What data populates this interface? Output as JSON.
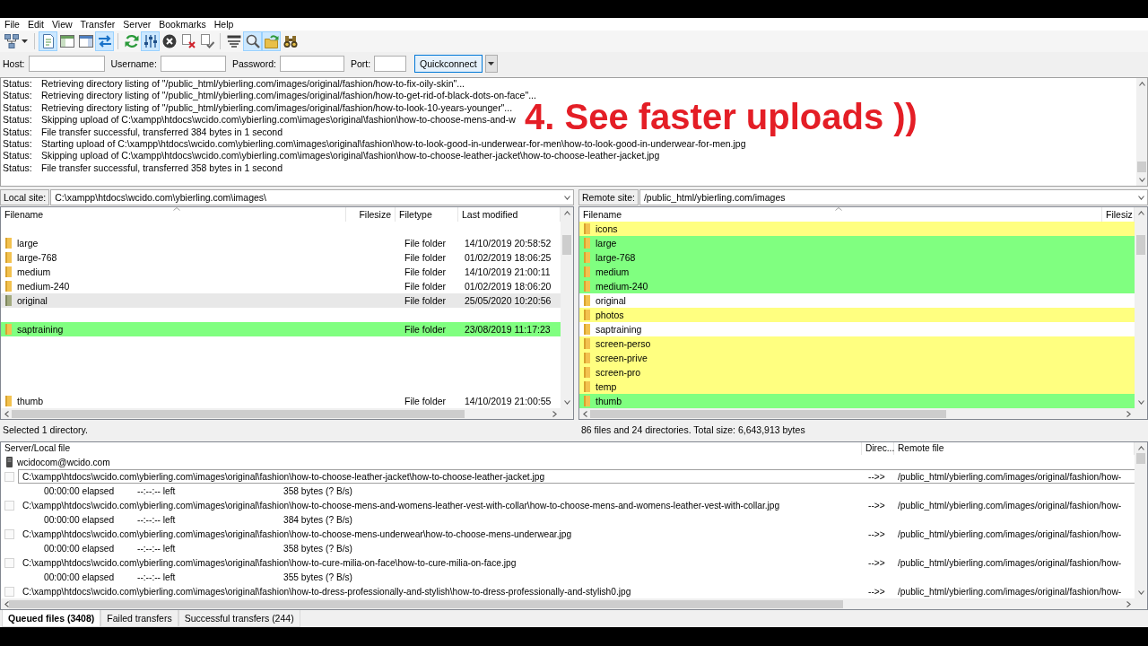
{
  "menu": [
    "File",
    "Edit",
    "View",
    "Transfer",
    "Server",
    "Bookmarks",
    "Help"
  ],
  "toolbar": [
    {
      "kind": "sitemanager",
      "pressed": false
    },
    {
      "kind": "separator"
    },
    {
      "kind": "log",
      "pressed": true
    },
    {
      "kind": "localtree",
      "pressed": false
    },
    {
      "kind": "remotetree",
      "pressed": false
    },
    {
      "kind": "queue",
      "pressed": true
    },
    {
      "kind": "separator"
    },
    {
      "kind": "refresh",
      "pressed": false
    },
    {
      "kind": "process",
      "pressed": true
    },
    {
      "kind": "cancel",
      "pressed": false
    },
    {
      "kind": "disconnect",
      "pressed": false
    },
    {
      "kind": "reconnect",
      "pressed": false
    },
    {
      "kind": "separator"
    },
    {
      "kind": "filter",
      "pressed": false
    },
    {
      "kind": "compare",
      "pressed": true
    },
    {
      "kind": "sync",
      "pressed": true
    },
    {
      "kind": "search",
      "pressed": false
    }
  ],
  "quickconnect": {
    "fields": [
      {
        "label": "Host:"
      },
      {
        "label": "Username:"
      },
      {
        "label": "Password:"
      },
      {
        "label": "Port:"
      }
    ],
    "button": "Quickconnect"
  },
  "message_log": {
    "lines": [
      {
        "label": "Status:",
        "text": "Retrieving directory listing of \"/public_html/ybierling.com/images/original/fashion/how-to-fix-oily-skin\"..."
      },
      {
        "label": "Status:",
        "text": "Retrieving directory listing of \"/public_html/ybierling.com/images/original/fashion/how-to-get-rid-of-black-dots-on-face\"..."
      },
      {
        "label": "Status:",
        "text": "Retrieving directory listing of \"/public_html/ybierling.com/images/original/fashion/how-to-look-10-years-younger\"..."
      },
      {
        "label": "Status:",
        "text": "Skipping upload of C:\\xampp\\htdocs\\wcido.com\\ybierling.com\\images\\original\\fashion\\how-to-choose-mens-and-w"
      },
      {
        "label": "Status:",
        "text": "File transfer successful, transferred 384 bytes in 1 second"
      },
      {
        "label": "Status:",
        "text": "Starting upload of C:\\xampp\\htdocs\\wcido.com\\ybierling.com\\images\\original\\fashion\\how-to-look-good-in-underwear-for-men\\how-to-look-good-in-underwear-for-men.jpg"
      },
      {
        "label": "Status:",
        "text": "Skipping upload of C:\\xampp\\htdocs\\wcido.com\\ybierling.com\\images\\original\\fashion\\how-to-choose-leather-jacket\\how-to-choose-leather-jacket.jpg"
      },
      {
        "label": "Status:",
        "text": "File transfer successful, transferred 358 bytes in 1 second"
      }
    ]
  },
  "video_caption": {
    "text": "4. See faster uploads ))"
  },
  "local_site": {
    "label": "Local site:",
    "path": "C:\\xampp\\htdocs\\wcido.com\\ybierling.com\\images\\",
    "columns": [
      "Filename",
      "Filesize",
      "Filetype",
      "Last modified"
    ],
    "rows": [
      {
        "kind": "gap"
      },
      {
        "kind": "folder",
        "name": "large",
        "filetype": "File folder",
        "modified": "14/10/2019 20:58:52",
        "selected": false
      },
      {
        "kind": "folder",
        "name": "large-768",
        "filetype": "File folder",
        "modified": "01/02/2019 18:06:25",
        "selected": false
      },
      {
        "kind": "folder",
        "name": "medium",
        "filetype": "File folder",
        "modified": "14/10/2019 21:00:11",
        "selected": false
      },
      {
        "kind": "folder",
        "name": "medium-240",
        "filetype": "File folder",
        "modified": "01/02/2019 18:06:20",
        "selected": false
      },
      {
        "kind": "folder",
        "name": "original",
        "filetype": "File folder",
        "modified": "25/05/2020 10:20:56",
        "selected": true
      },
      {
        "kind": "gap"
      },
      {
        "kind": "folder",
        "name": "saptraining",
        "filetype": "File folder",
        "modified": "23/08/2019 11:17:23",
        "selected": false,
        "color": "#80ff80"
      },
      {
        "kind": "gap"
      },
      {
        "kind": "gap"
      },
      {
        "kind": "gap"
      },
      {
        "kind": "gap"
      },
      {
        "kind": "folder",
        "name": "thumb",
        "filetype": "File folder",
        "modified": "14/10/2019 21:00:55",
        "selected": false
      }
    ],
    "status": "Selected 1 directory."
  },
  "remote_site": {
    "label": "Remote site:",
    "path": "/public_html/ybierling.com/images",
    "columns": [
      "Filename",
      "Filesiz"
    ],
    "rows": [
      {
        "kind": "folder",
        "name": "icons",
        "selected": false,
        "color": "#ffff80"
      },
      {
        "kind": "folder",
        "name": "large",
        "selected": false,
        "color": "#80ff80"
      },
      {
        "kind": "folder",
        "name": "large-768",
        "selected": false,
        "color": "#80ff80"
      },
      {
        "kind": "folder",
        "name": "medium",
        "selected": false,
        "color": "#80ff80"
      },
      {
        "kind": "folder",
        "name": "medium-240",
        "selected": false,
        "color": "#80ff80"
      },
      {
        "kind": "folder",
        "name": "original",
        "selected": false
      },
      {
        "kind": "folder",
        "name": "photos",
        "selected": false,
        "color": "#ffff80"
      },
      {
        "kind": "folder",
        "name": "saptraining",
        "selected": false
      },
      {
        "kind": "folder",
        "name": "screen-perso",
        "selected": false,
        "color": "#ffff80"
      },
      {
        "kind": "folder",
        "name": "screen-prive",
        "selected": false,
        "color": "#ffff80"
      },
      {
        "kind": "folder",
        "name": "screen-pro",
        "selected": false,
        "color": "#ffff80"
      },
      {
        "kind": "folder",
        "name": "temp",
        "selected": false,
        "color": "#ffff80"
      },
      {
        "kind": "folder",
        "name": "thumb",
        "selected": false,
        "color": "#80ff80"
      }
    ],
    "status": "86 files and 24 directories. Total size: 6,643,913 bytes"
  },
  "queue": {
    "columns": [
      "Server/Local file",
      "Direc...",
      "Remote file"
    ],
    "server": "wcidocom@wcido.com",
    "items": [
      {
        "local": "C:\\xampp\\htdocs\\wcido.com\\ybierling.com\\images\\original\\fashion\\how-to-choose-leather-jacket\\how-to-choose-leather-jacket.jpg",
        "direction": "-->>",
        "remote": "/public_html/ybierling.com/images/original/fashion/how-",
        "elapsed": "00:00:00 elapsed",
        "left": "--:--:-- left",
        "size": "358 bytes (? B/s)",
        "focused": true
      },
      {
        "local": "C:\\xampp\\htdocs\\wcido.com\\ybierling.com\\images\\original\\fashion\\how-to-choose-mens-and-womens-leather-vest-with-collar\\how-to-choose-mens-and-womens-leather-vest-with-collar.jpg",
        "direction": "-->>",
        "remote": "/public_html/ybierling.com/images/original/fashion/how-",
        "elapsed": "00:00:00 elapsed",
        "left": "--:--:-- left",
        "size": "384 bytes (? B/s)",
        "focused": false
      },
      {
        "local": "C:\\xampp\\htdocs\\wcido.com\\ybierling.com\\images\\original\\fashion\\how-to-choose-mens-underwear\\how-to-choose-mens-underwear.jpg",
        "direction": "-->>",
        "remote": "/public_html/ybierling.com/images/original/fashion/how-",
        "elapsed": "00:00:00 elapsed",
        "left": "--:--:-- left",
        "size": "358 bytes (? B/s)",
        "focused": false
      },
      {
        "local": "C:\\xampp\\htdocs\\wcido.com\\ybierling.com\\images\\original\\fashion\\how-to-cure-milia-on-face\\how-to-cure-milia-on-face.jpg",
        "direction": "-->>",
        "remote": "/public_html/ybierling.com/images/original/fashion/how-",
        "elapsed": "00:00:00 elapsed",
        "left": "--:--:-- left",
        "size": "355 bytes (? B/s)",
        "focused": false
      },
      {
        "local": "C:\\xampp\\htdocs\\wcido.com\\ybierling.com\\images\\original\\fashion\\how-to-dress-professionally-and-stylish\\how-to-dress-professionally-and-stylish0.jpg",
        "direction": "-->>",
        "remote": "/public_html/ybierling.com/images/original/fashion/how-",
        "focused": false
      }
    ]
  },
  "tabs": [
    {
      "label": "Queued files (3408)",
      "selected": true
    },
    {
      "label": "Failed transfers",
      "selected": false
    },
    {
      "label": "Successful transfers (244)",
      "selected": false
    }
  ]
}
